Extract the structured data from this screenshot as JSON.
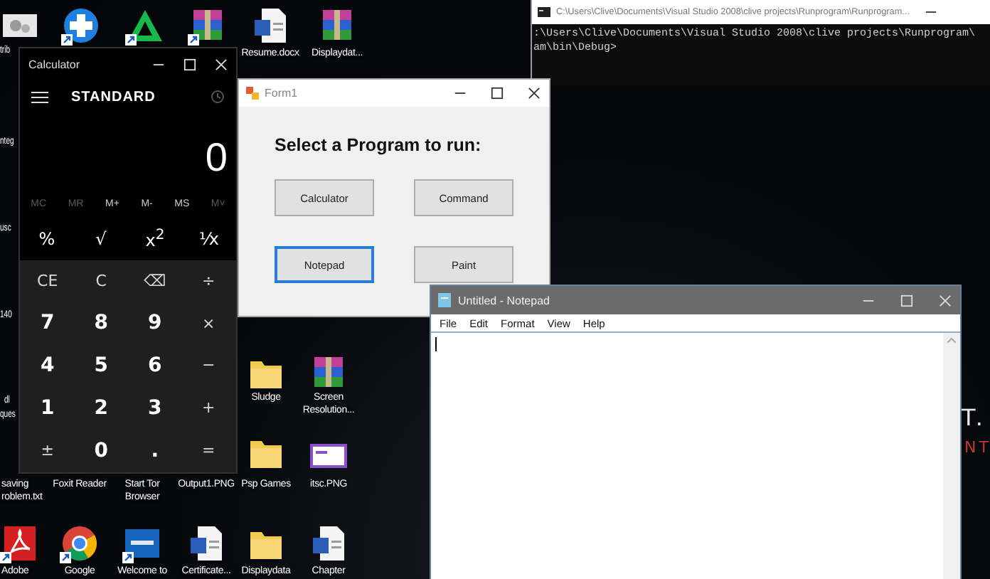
{
  "desktop": {
    "icons": [
      {
        "kind": "settings",
        "shortcut": false
      },
      {
        "kind": "plus",
        "shortcut": true
      },
      {
        "kind": "triangle",
        "shortcut": true
      },
      {
        "kind": "archive",
        "shortcut": true
      },
      {
        "label": "Resume.docx",
        "kind": "document",
        "shortcut": false
      },
      {
        "label": "Displaydat...",
        "kind": "archive",
        "shortcut": false
      },
      {
        "label": "Sludge",
        "kind": "folder",
        "shortcut": false
      },
      {
        "label": "Screen Resolution...",
        "kind": "archive",
        "shortcut": false
      },
      {
        "label": "saving roblem.txt",
        "kind": "covered"
      },
      {
        "label": "Foxit Reader",
        "kind": "covered"
      },
      {
        "label": "Start Tor Browser",
        "kind": "covered"
      },
      {
        "label": "Output1.PNG",
        "kind": "covered"
      },
      {
        "label": "Psp Games",
        "kind": "folder",
        "shortcut": false
      },
      {
        "label": "itsc.PNG",
        "kind": "image",
        "shortcut": false
      },
      {
        "label": "Adobe",
        "kind": "pdf",
        "shortcut": true
      },
      {
        "label": "Google",
        "kind": "browser",
        "shortcut": true
      },
      {
        "label": "Welcome to",
        "kind": "logo",
        "shortcut": true
      },
      {
        "label": "Certificate...",
        "kind": "document",
        "shortcut": false
      },
      {
        "label": "Displaydata",
        "kind": "folder",
        "shortcut": false
      },
      {
        "label": "Chapter",
        "kind": "document",
        "shortcut": false
      }
    ],
    "partial_labels": [
      "trib",
      "nteg",
      "usc",
      "140",
      "dl",
      "ques"
    ],
    "wallpaper_texts": [
      {
        "text": "T.",
        "color": "#e8e8e8"
      },
      {
        "text": "NT",
        "color": "#c0392b"
      }
    ]
  },
  "console": {
    "title": "C:\\Users\\Clive\\Documents\\Visual Studio 2008\\clive projects\\Runprogram\\Runprogram...",
    "lines": [
      ":\\Users\\Clive\\Documents\\Visual Studio 2008\\clive projects\\Runprogram\\",
      "am\\bin\\Debug>"
    ]
  },
  "calculator": {
    "title": "Calculator",
    "mode": "STANDARD",
    "display": "0",
    "memory_buttons": [
      {
        "label": "MC",
        "disabled": true
      },
      {
        "label": "MR",
        "disabled": true
      },
      {
        "label": "M+",
        "disabled": false
      },
      {
        "label": "M-",
        "disabled": false
      },
      {
        "label": "MS",
        "disabled": false
      },
      {
        "label": "M˅",
        "disabled": true
      }
    ],
    "function_keys": [
      "%",
      "√",
      "x$^{2}$",
      "¹⁄x"
    ],
    "keypad": [
      {
        "label": "CE",
        "kind": "operator"
      },
      {
        "label": "C",
        "kind": "operator"
      },
      {
        "label": "⌫",
        "kind": "operator"
      },
      {
        "label": "÷",
        "kind": "operator"
      },
      {
        "label": "7",
        "kind": "digit"
      },
      {
        "label": "8",
        "kind": "digit"
      },
      {
        "label": "9",
        "kind": "digit"
      },
      {
        "label": "×",
        "kind": "operator"
      },
      {
        "label": "4",
        "kind": "digit"
      },
      {
        "label": "5",
        "kind": "digit"
      },
      {
        "label": "6",
        "kind": "digit"
      },
      {
        "label": "−",
        "kind": "operator"
      },
      {
        "label": "1",
        "kind": "digit"
      },
      {
        "label": "2",
        "kind": "digit"
      },
      {
        "label": "3",
        "kind": "digit"
      },
      {
        "label": "+",
        "kind": "operator"
      },
      {
        "label": "±",
        "kind": "operator"
      },
      {
        "label": "0",
        "kind": "digit"
      },
      {
        "label": ".",
        "kind": "digit"
      },
      {
        "label": "=",
        "kind": "operator"
      }
    ]
  },
  "form": {
    "title": "Form1",
    "heading": "Select a Program to run:",
    "buttons": [
      {
        "label": "Calculator",
        "selected": false
      },
      {
        "label": "Command",
        "selected": false
      },
      {
        "label": "Notepad",
        "selected": true
      },
      {
        "label": "Paint",
        "selected": false
      }
    ]
  },
  "notepad": {
    "title": "Untitled - Notepad",
    "menu": [
      "File",
      "Edit",
      "Format",
      "View",
      "Help"
    ]
  }
}
